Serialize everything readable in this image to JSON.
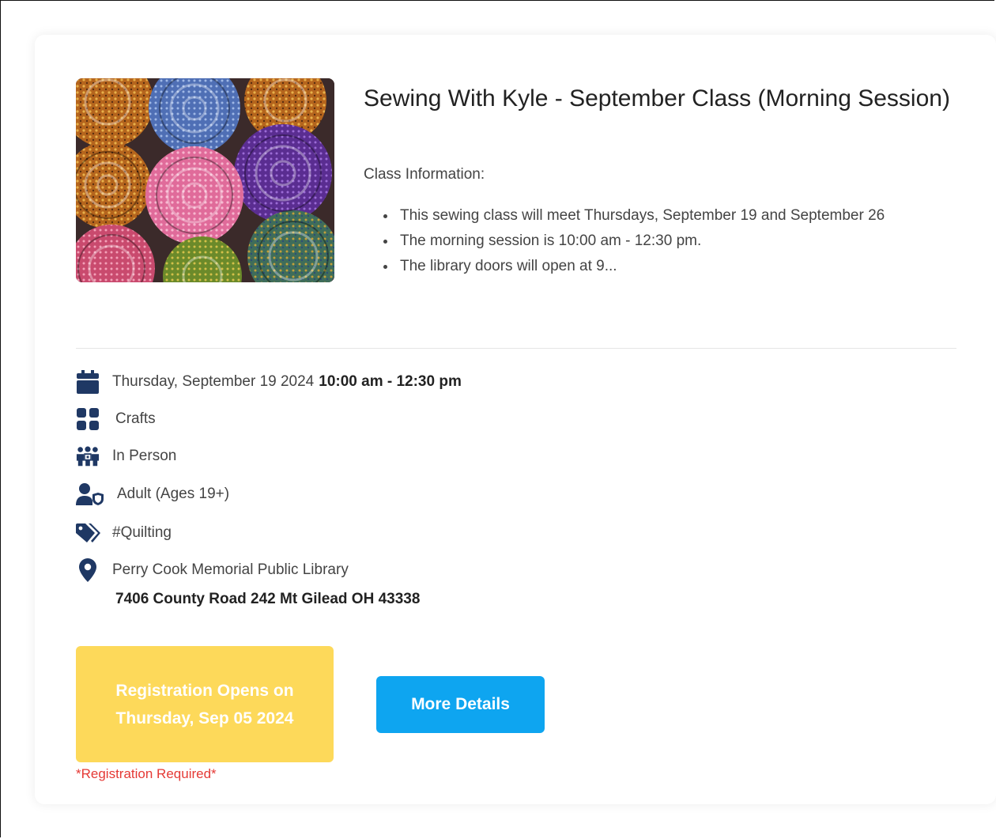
{
  "event": {
    "title": "Sewing With Kyle - September Class (Morning Session)",
    "class_info_label": "Class Information:",
    "bullets": [
      "This sewing class will meet Thursdays, September 19 and September 26",
      "The morning session is 10:00 am - 12:30 pm.",
      "The library doors will open at 9..."
    ],
    "image_alt": "Rolled fabric bundles"
  },
  "meta": {
    "date": "Thursday, September 19 2024",
    "time": "10:00 am - 12:30 pm",
    "category": "Crafts",
    "format": "In Person",
    "audience": "Adult (Ages 19+)",
    "tag": "#Quilting",
    "location_name": "Perry Cook Memorial Public Library",
    "location_address": "7406 County Road 242 Mt Gilead OH 43338"
  },
  "icons": {
    "date": "calendar-icon",
    "category": "category-grid-icon",
    "format": "people-group-icon",
    "audience": "user-shield-icon",
    "tag": "tags-icon",
    "location": "map-marker-icon"
  },
  "actions": {
    "registration_status": "Registration Opens on Thursday, Sep 05 2024",
    "registration_note": "*Registration Required*",
    "details_label": "More Details"
  },
  "colors": {
    "icon": "#1f3864",
    "registration_bg": "#fdd95a",
    "details_bg": "#0ea5f0",
    "required_text": "#e53935"
  }
}
